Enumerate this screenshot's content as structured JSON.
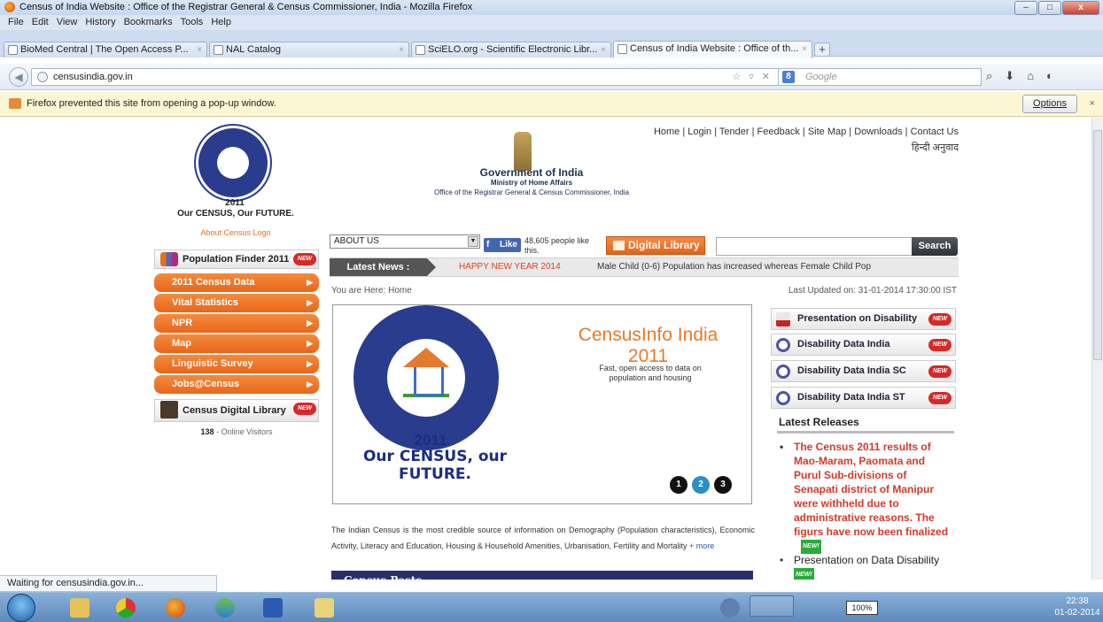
{
  "window": {
    "title": "Census of India Website : Office of the Registrar General & Census Commissioner, India - Mozilla Firefox",
    "controls": {
      "minimize": "–",
      "maximize": "□",
      "close": "x"
    }
  },
  "menu": [
    "File",
    "Edit",
    "View",
    "History",
    "Bookmarks",
    "Tools",
    "Help"
  ],
  "tabs": [
    {
      "label": "BioMed Central | The Open Access P...",
      "close": "×"
    },
    {
      "label": "NAL Catalog",
      "close": "×"
    },
    {
      "label": "SciELO.org - Scientific Electronic Libr...",
      "close": "×"
    },
    {
      "label": "Census of India Website : Office of th...",
      "close": "×"
    }
  ],
  "new_tab_label": "+",
  "navbar": {
    "url": "censusindia.gov.in",
    "search_placeholder": "Google",
    "search_engine_icon": "8"
  },
  "popup_notice": {
    "text": "Firefox prevented this site from opening a pop-up window.",
    "options": "Options",
    "close": "×"
  },
  "site": {
    "logo": {
      "year": "2011",
      "slogan": "Our CENSUS, Our FUTURE.",
      "about": "About Census Logo"
    },
    "header": {
      "gov": "Government of India",
      "ministry": "Ministry of Home Affairs",
      "office": "Office of the Registrar General & Census Commissioner, India",
      "links": "Home | Login | Tender | Feedback | Site Map | Downloads | Contact Us",
      "hindi": "हिन्दी अनुवाद"
    },
    "sidebar": {
      "population_finder": "Population Finder 2011",
      "new_badge": "NEW",
      "menu": [
        "2011 Census Data",
        "Vital Statistics",
        "NPR",
        "Map",
        "Linguistic Survey",
        "Jobs@Census"
      ],
      "arrow": "▶",
      "digital_library": "Census Digital Library",
      "visitors_count": "138",
      "visitors_label": "- Online Visitors"
    },
    "controls": {
      "about_select": "ABOUT US",
      "dropdown_arrow": "▼",
      "like": "Like",
      "like_count": "48,605 people like this.",
      "digital_library_btn": "Digital Library",
      "search_btn": "Search"
    },
    "news": {
      "label": "Latest News :",
      "item1": "HAPPY NEW YEAR 2014",
      "item2": "Male Child (0-6) Population has increased whereas Female Child Pop"
    },
    "breadcrumb": "You are Here: Home",
    "last_updated": "Last Updated on: 31-01-2014 17:30:00 IST",
    "banner": {
      "year": "2011",
      "slogan": "Our CENSUS, our FUTURE.",
      "title": "CensusInfo India 2011",
      "desc": "Fast, open access to data on population and housing",
      "dots": [
        "1",
        "2",
        "3"
      ],
      "active_dot": 2
    },
    "intro": "The Indian Census is the most credible source of information on Demography (Population characteristics), Economic Activity, Literacy and Education, Housing & Household Amenities, Urbanisation, Fertility and Mortality",
    "more": "+ more",
    "posts_heading": "Census Posts",
    "right": {
      "links": [
        "Presentation on Disability",
        "Disability Data India",
        "Disability Data India SC",
        "Disability Data India ST"
      ],
      "latest_releases": "Latest Releases",
      "releases": [
        "The Census 2011 results of Mao-Maram, Paomata and Purul Sub-divisions of Senapati district of Manipur were withheld due to administrative reasons. The figurs have now been finalized",
        "Presentation on Data Disability"
      ],
      "new_small": "NEW!"
    }
  },
  "statusbar": "Waiting for censusindia.gov.in...",
  "taskbar": {
    "battery": "100%",
    "time": "22:38",
    "date": "01-02-2014"
  },
  "colors": {
    "orange": "#e9661a",
    "navy": "#282f6b",
    "news_red": "#e0401a",
    "release_red": "#d13a2a",
    "chrome_blue": "#cddcee"
  }
}
